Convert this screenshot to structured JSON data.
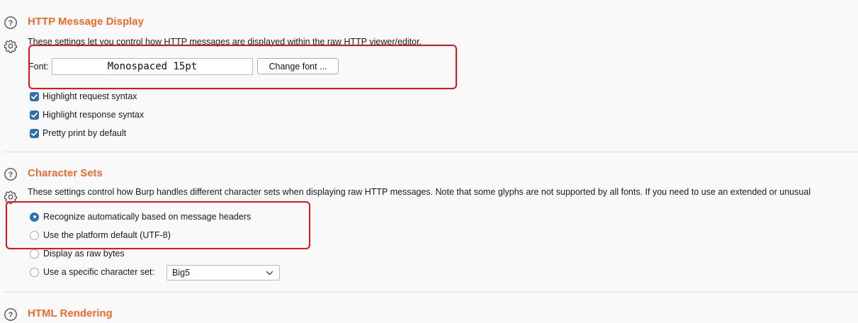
{
  "http_message_display": {
    "title": "HTTP Message Display",
    "description": "These settings let you control how HTTP messages are displayed within the raw HTTP viewer/editor.",
    "font_label": "Font:",
    "font_value": "Monospaced 15pt",
    "change_font_label": "Change font ...",
    "options": [
      {
        "label": "Highlight request syntax",
        "checked": true
      },
      {
        "label": "Highlight response syntax",
        "checked": true
      },
      {
        "label": "Pretty print by default",
        "checked": true
      }
    ]
  },
  "character_sets": {
    "title": "Character Sets",
    "description": "These settings control how Burp handles different character sets when displaying raw HTTP messages. Note that some glyphs are not supported by all fonts. If you need to use an extended or unusual",
    "options": [
      {
        "label": "Recognize automatically based on message headers",
        "selected": true
      },
      {
        "label": "Use the platform default (UTF-8)",
        "selected": false
      },
      {
        "label": "Display as raw bytes",
        "selected": false
      },
      {
        "label": "Use a specific character set:",
        "selected": false
      }
    ],
    "specific_charset_value": "Big5"
  },
  "html_rendering": {
    "title": "HTML Rendering"
  },
  "colors": {
    "accent": "#f26a2a",
    "highlight_border": "#e8101a",
    "control_blue": "#2f6fb0"
  },
  "icons": {
    "help": "help-circle-icon",
    "settings": "gear-icon",
    "check": "checkmark-icon",
    "dropdown": "chevron-down-icon"
  }
}
